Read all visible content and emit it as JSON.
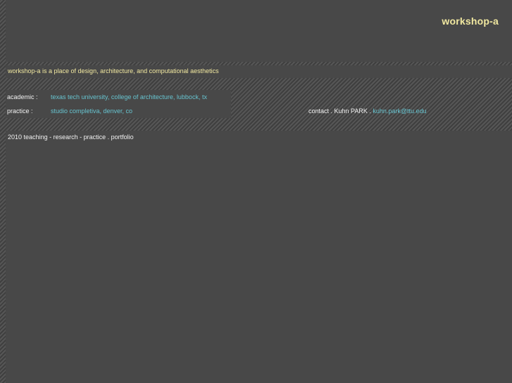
{
  "header": {
    "site_title": "workshop-a"
  },
  "tagline": "workshop-a is a place of design, architecture, and computational aesthetics",
  "info": {
    "academic": {
      "label": "academic :",
      "link": "texas tech university, college of architecture, lubbock, tx"
    },
    "practice": {
      "label": "practice :",
      "link": "studio completiva, denver, co"
    },
    "contact": {
      "prefix": "contact . Kuhn PARK . ",
      "email": "kuhn.park@ttu.edu"
    }
  },
  "nav": {
    "year": "2010",
    "teaching": "teaching",
    "sep1": " - ",
    "research": "research",
    "sep2": " - ",
    "practice": "practice",
    "sep3": " . ",
    "portfolio": "portfolio"
  },
  "colors": {
    "title": "#f1e8a0",
    "link": "#67c3cf",
    "text": "#f2f2f2",
    "panel": "#484848"
  }
}
